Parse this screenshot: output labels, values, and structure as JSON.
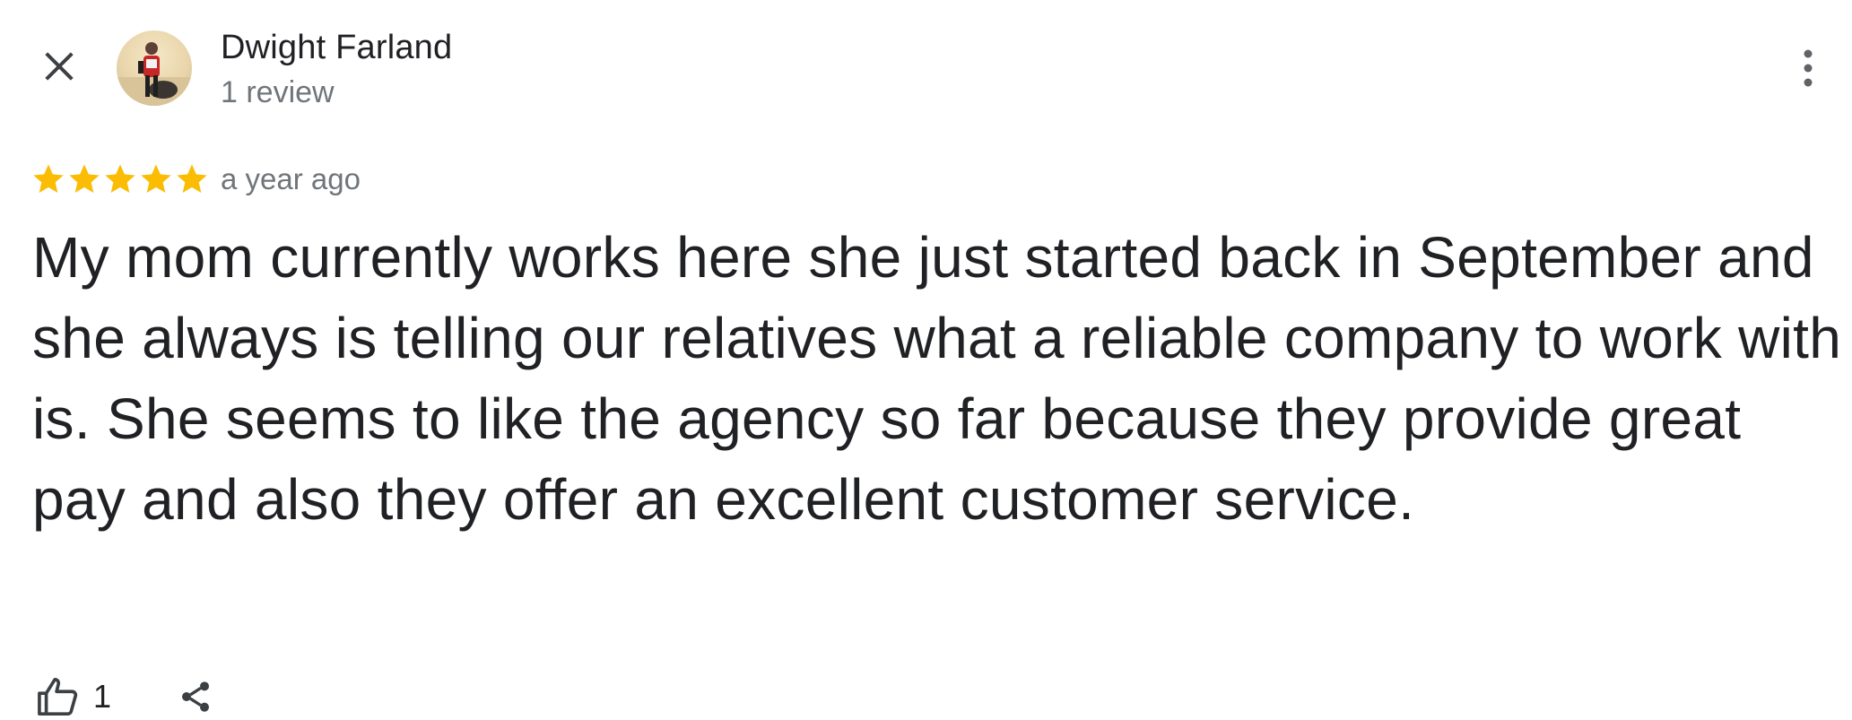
{
  "header": {
    "close_icon": "close-icon",
    "author_name": "Dwight Farland",
    "author_meta": "1 review",
    "more_icon": "more-vert-icon"
  },
  "review": {
    "rating": 5,
    "rating_max": 5,
    "star_color": "#fbbc04",
    "timestamp": "a year ago",
    "text": "My mom currently works here she just started back in September and she always is telling our relatives what a reliable company to work with is. She seems to like the agency so far because they provide great pay and also they offer an excellent customer service."
  },
  "actions": {
    "like_icon": "thumb-up-icon",
    "like_count": "1",
    "share_icon": "share-icon"
  }
}
